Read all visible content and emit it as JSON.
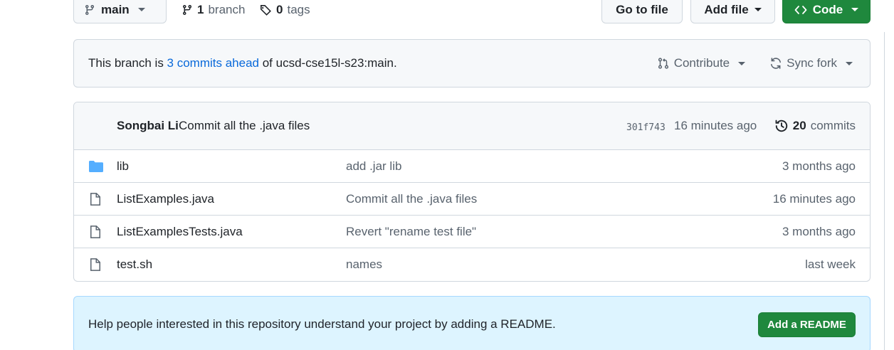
{
  "toolbar": {
    "branch_label": "main",
    "branch_count": "1",
    "branch_word": "branch",
    "tag_count": "0",
    "tag_word": "tags",
    "goto_file": "Go to file",
    "add_file": "Add file",
    "code": "Code"
  },
  "status": {
    "prefix": "This branch is ",
    "link": "3 commits ahead",
    "suffix": " of ucsd-cse15l-s23:main.",
    "contribute": "Contribute",
    "sync_fork": "Sync fork"
  },
  "commit": {
    "author": "Songbai Li",
    "message": "Commit all the .java files",
    "sha": "301f743",
    "time": "16 minutes ago",
    "count": "20",
    "count_word": "commits"
  },
  "files": [
    {
      "name": "lib",
      "type": "folder",
      "commit": "add .jar lib",
      "time": "3 months ago"
    },
    {
      "name": "ListExamples.java",
      "type": "file",
      "commit": "Commit all the .java files",
      "time": "16 minutes ago"
    },
    {
      "name": "ListExamplesTests.java",
      "type": "file",
      "commit": "Revert \"rename test file\"",
      "time": "3 months ago"
    },
    {
      "name": "test.sh",
      "type": "file",
      "commit": "names",
      "time": "last week"
    }
  ],
  "readme": {
    "text": "Help people interested in this repository understand your project by adding a README.",
    "button": "Add a README"
  },
  "colors": {
    "accent_green": "#1f883d",
    "link_blue": "#0969da",
    "folder_blue": "#54aeff"
  }
}
